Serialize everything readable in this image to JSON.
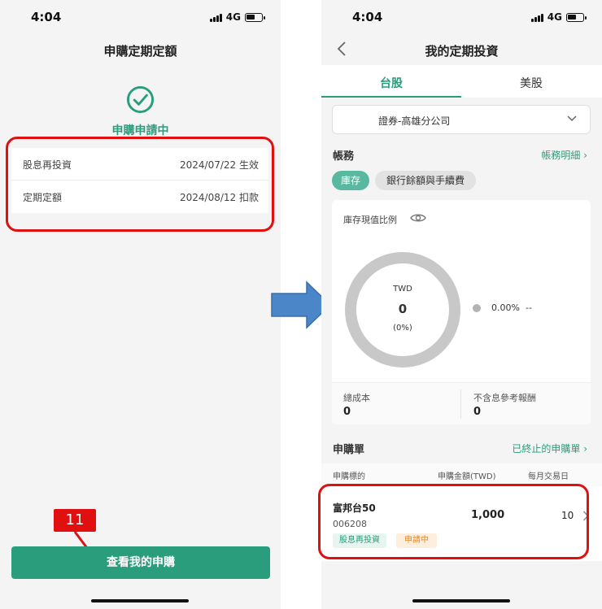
{
  "left_screen": {
    "status": {
      "time": "4:04",
      "network": "4G"
    },
    "title": "申購定期定額",
    "status_label": "申購申請中",
    "info_rows": [
      {
        "label": "股息再投資",
        "value": "2024/07/22 生效"
      },
      {
        "label": "定期定額",
        "value": "2024/08/12 扣款"
      }
    ],
    "step_number": "11",
    "view_button": "查看我的申購"
  },
  "right_screen": {
    "status": {
      "time": "4:04",
      "network": "4G"
    },
    "title": "我的定期投資",
    "tabs": [
      {
        "label": "台股",
        "active": true
      },
      {
        "label": "美股",
        "active": false
      }
    ],
    "branch": "證券-高雄分公司",
    "account_section": {
      "title": "帳務",
      "link": "帳務明細"
    },
    "chips": [
      {
        "label": "庫存",
        "selected": true
      },
      {
        "label": "銀行餘額與手續費",
        "selected": false
      }
    ],
    "holdings": {
      "label": "庫存現值比例",
      "currency": "TWD",
      "total": "0",
      "percent": "(0%)",
      "legend": {
        "pct": "0.00%",
        "name": "--"
      },
      "total_cost_label": "總成本",
      "total_cost": "0",
      "ref_return_label": "不含息參考報酬",
      "ref_return": "0"
    },
    "subscriptions": {
      "title": "申購單",
      "link": "已終止的申購單",
      "columns": [
        "申購標的",
        "申購金額(TWD)",
        "每月交易日"
      ],
      "items": [
        {
          "name": "富邦台50",
          "code": "006208",
          "amount": "1,000",
          "day": "10",
          "tags": [
            "股息再投資",
            "申請中"
          ]
        }
      ]
    }
  },
  "colors": {
    "accent": "#2a9d7c",
    "highlight_red": "#e01010",
    "arrow_blue": "#4a86c8",
    "donut_grey": "#c8c8c8"
  }
}
